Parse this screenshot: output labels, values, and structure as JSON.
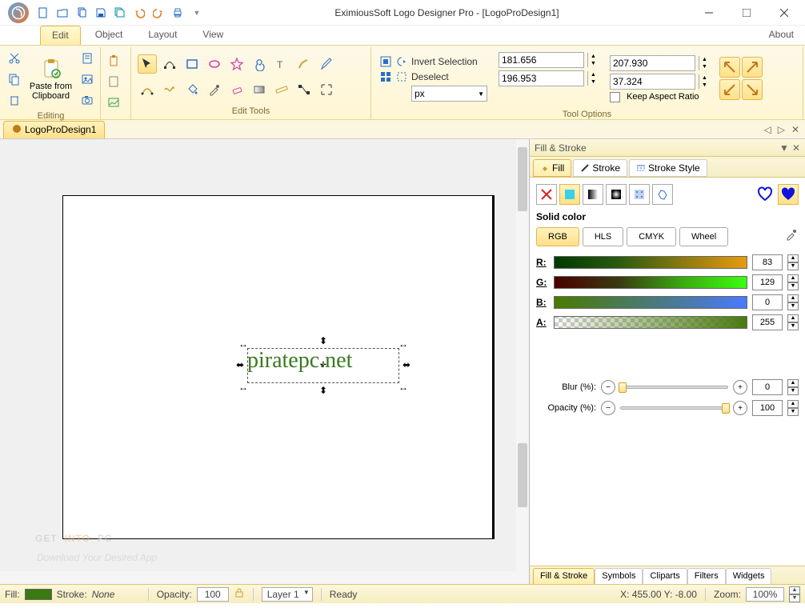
{
  "title": "EximiousSoft Logo Designer Pro - [LogoProDesign1]",
  "about": "About",
  "tabs": {
    "edit": "Edit",
    "object": "Object",
    "layout": "Layout",
    "view": "View"
  },
  "ribbon": {
    "editing_title": "Editing",
    "paste_label": "Paste from Clipboard",
    "tools_title": "Edit Tools",
    "opts_title": "Tool Options",
    "invert": "Invert Selection",
    "deselect": "Deselect",
    "px": "px",
    "keep": "Keep Aspect Ratio",
    "x": "181.656",
    "y": "207.930",
    "w": "196.953",
    "h": "37.324"
  },
  "doc_tab": "LogoProDesign1",
  "canvas_text": "piratepc.net",
  "watermark1": "GET",
  "watermark2": "INTO",
  "watermark3": "PC",
  "watermark_sub": "Download Your Desired App",
  "panel": {
    "title": "Fill & Stroke",
    "tab_fill": "Fill",
    "tab_stroke": "Stroke",
    "tab_style": "Stroke Style",
    "solid": "Solid color",
    "rgb": "RGB",
    "hls": "HLS",
    "cmyk": "CMYK",
    "wheel": "Wheel",
    "r": "R:",
    "g": "G:",
    "b": "B:",
    "a": "A:",
    "rv": "83",
    "gv": "129",
    "bv": "0",
    "av": "255",
    "blur": "Blur (%):",
    "blurv": "0",
    "opacity": "Opacity (%):",
    "opacityv": "100",
    "bt_fill": "Fill & Stroke",
    "bt_sym": "Symbols",
    "bt_clip": "Cliparts",
    "bt_filt": "Filters",
    "bt_widg": "Widgets"
  },
  "status": {
    "fill": "Fill:",
    "stroke": "Stroke:",
    "stroke_val": "None",
    "opacity": "Opacity:",
    "opacity_val": "100",
    "layer": "Layer 1",
    "ready": "Ready",
    "xy": "X:  455.00 Y:   -8.00",
    "zoom": "Zoom:",
    "zoom_val": "100%"
  }
}
